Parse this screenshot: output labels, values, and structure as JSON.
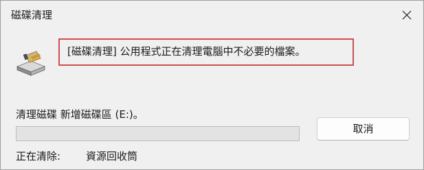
{
  "window": {
    "title": "磁碟清理",
    "close_icon": "close-icon"
  },
  "dialog": {
    "app_icon": "disk-cleanup-icon",
    "message": "[磁碟清理] 公用程式正在清理電腦中不必要的檔案。",
    "highlight_color": "#e0464b",
    "drive_status": "清理磁碟 新增磁碟區 (E:)。",
    "progress_fraction": 0,
    "progress_color": "#06b025",
    "cancel_label": "取消",
    "cleaning_label": "正在清除:",
    "cleaning_value": "資源回收筒"
  }
}
